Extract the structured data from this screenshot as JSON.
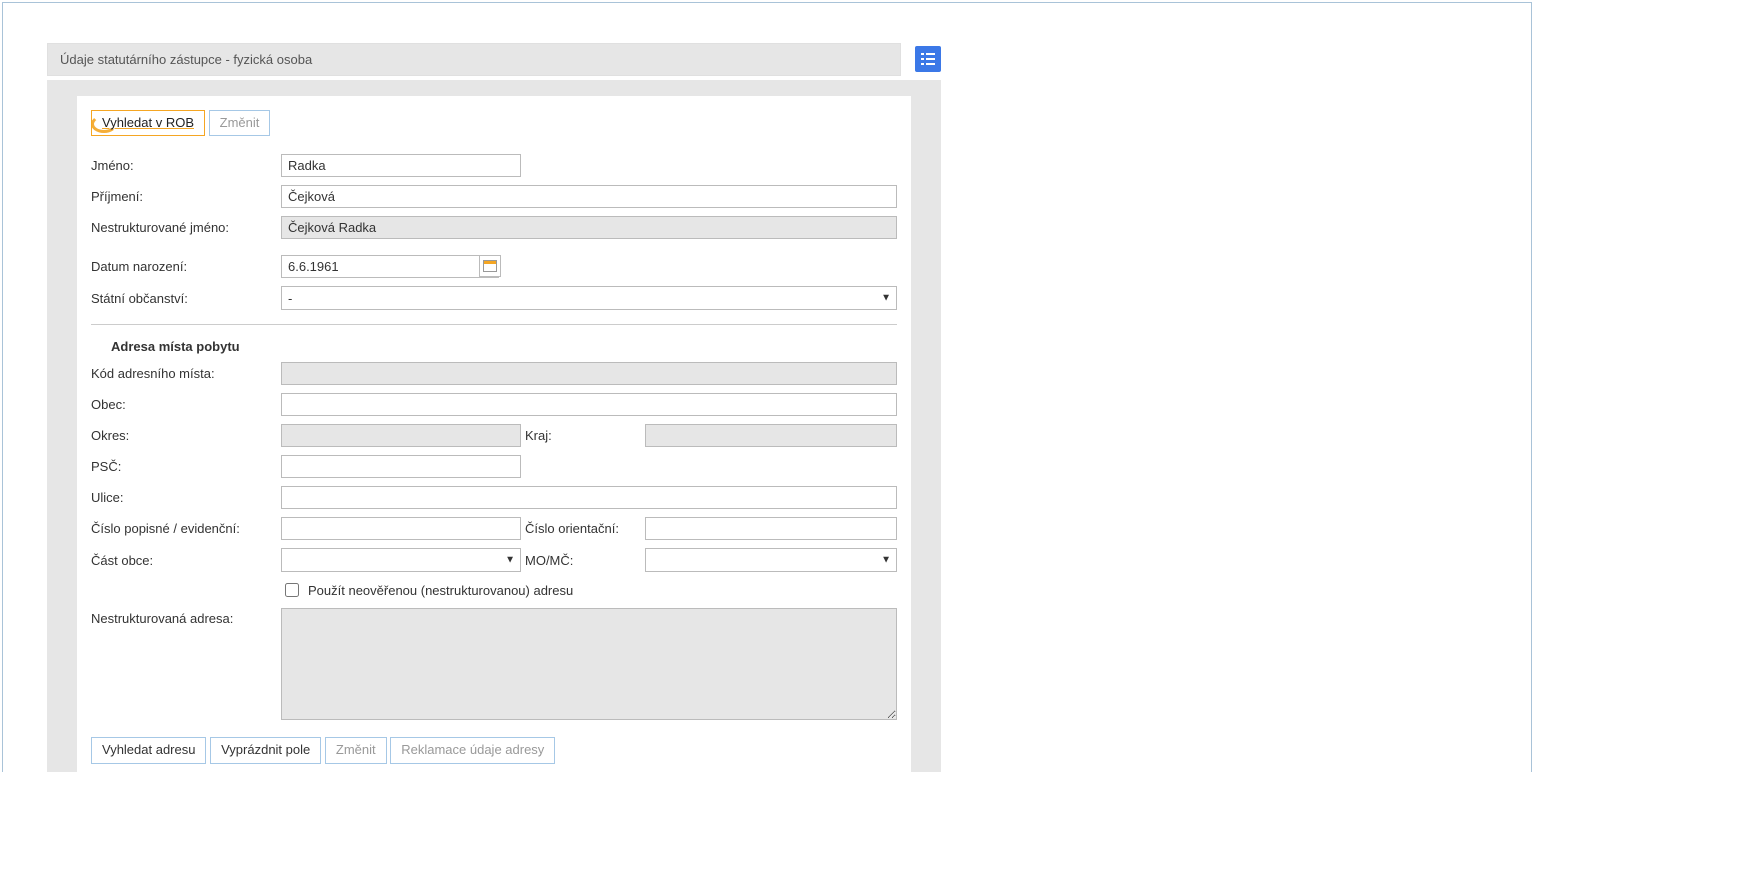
{
  "header": {
    "title": "Údaje statutárního zástupce - fyzická osoba"
  },
  "topButtons": {
    "searchRob": "Vyhledat v ROB",
    "change": "Změnit"
  },
  "person": {
    "firstNameLabel": "Jméno:",
    "firstName": "Radka",
    "lastNameLabel": "Příjmení:",
    "lastName": "Čejková",
    "unstructuredNameLabel": "Nestrukturované jméno:",
    "unstructuredName": "Čejková Radka",
    "dobLabel": "Datum narození:",
    "dob": "6.6.1961",
    "citizenshipLabel": "Státní občanství:",
    "citizenship": "-"
  },
  "address": {
    "sectionTitle": "Adresa místa pobytu",
    "codeLabel": "Kód adresního místa:",
    "code": "",
    "cityLabel": "Obec:",
    "city": "",
    "districtLabel": "Okres:",
    "district": "",
    "regionLabel": "Kraj:",
    "region": "",
    "zipLabel": "PSČ:",
    "zip": "",
    "streetLabel": "Ulice:",
    "street": "",
    "houseNoLabel": "Číslo popisné / evidenční:",
    "houseNo": "",
    "orientNoLabel": "Číslo orientační:",
    "orientNo": "",
    "cityPartLabel": "Část obce:",
    "cityPart": "",
    "momcLabel": "MO/MČ:",
    "momc": "",
    "useUnverifiedLabel": "Použít neověřenou (nestrukturovanou) adresu",
    "unstructuredLabel": "Nestrukturovaná adresa:",
    "unstructured": ""
  },
  "bottomButtons": {
    "searchAddress": "Vyhledat adresu",
    "clearFields": "Vyprázdnit pole",
    "change": "Změnit",
    "complaint": "Reklamace údaje adresy"
  }
}
